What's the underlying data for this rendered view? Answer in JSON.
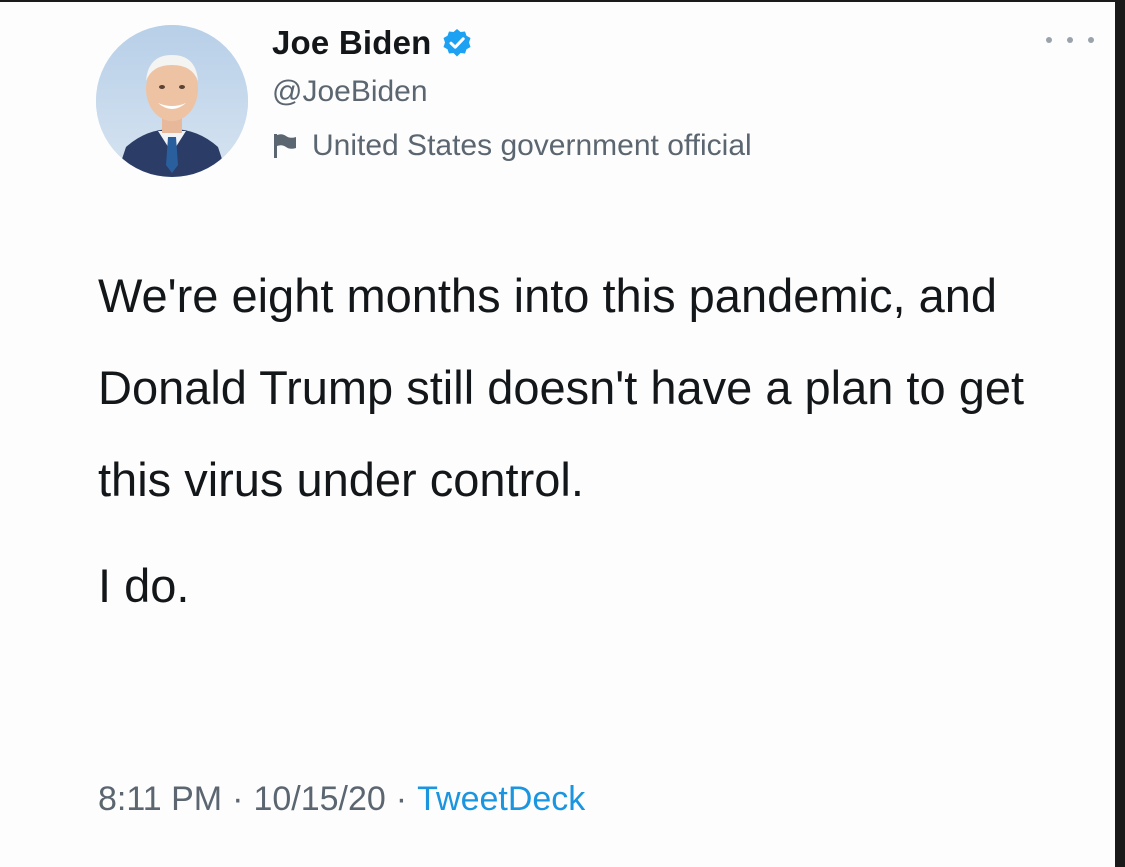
{
  "tweet": {
    "author": {
      "display_name": "Joe Biden",
      "handle": "@JoeBiden",
      "verified_icon": "verified-badge-icon",
      "label": "United States government official",
      "label_icon": "flag-icon"
    },
    "text_paragraph_1": "We're eight months into this pandemic, and Donald Trump still doesn't have a plan to get this virus under control.",
    "text_paragraph_2": "I do.",
    "time": "8:11 PM",
    "date": "10/15/20",
    "separator": "·",
    "source": "TweetDeck",
    "more_icon": "more-options-icon"
  },
  "colors": {
    "text_primary": "#14171a",
    "text_secondary": "#5b6670",
    "accent": "#1b95e0",
    "verified": "#1da1f2"
  }
}
